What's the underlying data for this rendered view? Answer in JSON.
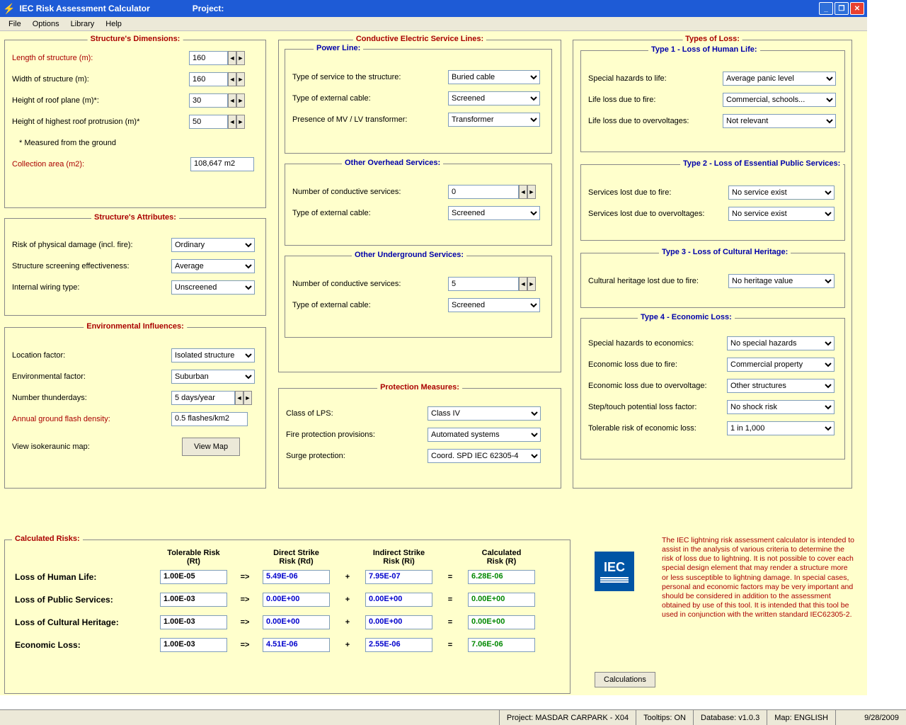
{
  "title": "IEC Risk Assessment Calculator",
  "project_label": "Project:",
  "menu": {
    "file": "File",
    "options": "Options",
    "library": "Library",
    "help": "Help"
  },
  "dims": {
    "legend": "Structure's Dimensions:",
    "length_lbl": "Length of structure (m):",
    "length_val": "160",
    "width_lbl": "Width of structure (m):",
    "width_val": "160",
    "roof_lbl": "Height of roof plane (m)*:",
    "roof_val": "30",
    "prot_lbl": "Height of highest roof protrusion (m)*",
    "prot_val": "50",
    "foot": "* Measured from the ground",
    "area_lbl": "Collection area (m2):",
    "area_val": "108,647 m2"
  },
  "attrs": {
    "legend": "Structure's Attributes:",
    "risk_lbl": "Risk of physical damage (incl. fire):",
    "risk_val": "Ordinary",
    "screen_lbl": "Structure screening effectiveness:",
    "screen_val": "Average",
    "wire_lbl": "Internal wiring type:",
    "wire_val": "Unscreened"
  },
  "env": {
    "legend": "Environmental Influences:",
    "loc_lbl": "Location factor:",
    "loc_val": "Isolated structure",
    "env_lbl": "Environmental factor:",
    "env_val": "Suburban",
    "thun_lbl": "Number thunderdays:",
    "thun_val": "5 days/year",
    "flash_lbl": "Annual ground flash density:",
    "flash_val": "0.5  flashes/km2",
    "map_lbl": "View isokeraunic map:",
    "map_btn": "View Map"
  },
  "cesl": {
    "legend": "Conductive Electric Service Lines:",
    "pl": "Power Line:",
    "type_svc_lbl": "Type of service to the structure:",
    "type_svc_val": "Buried cable",
    "ext_cable_lbl": "Type of external cable:",
    "ext_cable_val": "Screened",
    "mvlv_lbl": "Presence of MV / LV transformer:",
    "mvlv_val": "Transformer",
    "oos": "Other Overhead Services:",
    "oos_num_lbl": "Number of conductive services:",
    "oos_num_val": "0",
    "oos_ext_lbl": "Type of external cable:",
    "oos_ext_val": "Screened",
    "ous": "Other Underground Services:",
    "ous_num_lbl": "Number of conductive services:",
    "ous_num_val": "5",
    "ous_ext_lbl": "Type of external cable:",
    "ous_ext_val": "Screened"
  },
  "pm": {
    "legend": "Protection Measures:",
    "lps_lbl": "Class of LPS:",
    "lps_val": "Class IV",
    "fire_lbl": "Fire protection provisions:",
    "fire_val": "Automated systems",
    "surge_lbl": "Surge protection:",
    "surge_val": "Coord. SPD IEC 62305-4"
  },
  "types": {
    "legend": "Types of Loss:",
    "t1": "Type 1 - Loss of Human Life:",
    "t1a_lbl": "Special hazards to life:",
    "t1a_val": "Average panic level",
    "t1b_lbl": "Life loss due to fire:",
    "t1b_val": "Commercial, schools...",
    "t1c_lbl": "Life loss due to overvoltages:",
    "t1c_val": "Not relevant",
    "t2": "Type 2 - Loss of Essential Public Services:",
    "t2a_lbl": "Services lost due to fire:",
    "t2a_val": "No service exist",
    "t2b_lbl": "Services lost due to overvoltages:",
    "t2b_val": "No service exist",
    "t3": "Type 3 - Loss of Cultural Heritage:",
    "t3a_lbl": "Cultural heritage lost due to fire:",
    "t3a_val": "No heritage value",
    "t4": "Type 4 - Economic Loss:",
    "t4a_lbl": "Special hazards to economics:",
    "t4a_val": "No special hazards",
    "t4b_lbl": "Economic loss due to fire:",
    "t4b_val": "Commercial property",
    "t4c_lbl": "Economic loss due to overvoltage:",
    "t4c_val": "Other structures",
    "t4d_lbl": "Step/touch potential loss factor:",
    "t4d_val": "No shock risk",
    "t4e_lbl": "Tolerable risk of economic loss:",
    "t4e_val": "1 in 1,000"
  },
  "calc": {
    "legend": "Calculated Risks:",
    "h_tol1": "Tolerable Risk",
    "h_tol2": "(Rt)",
    "h_dir1": "Direct Strike",
    "h_dir2": "Risk (Rd)",
    "h_ind1": "Indirect Strike",
    "h_ind2": "Risk (Ri)",
    "h_cal1": "Calculated",
    "h_cal2": "Risk (R)",
    "rows": [
      {
        "lbl": "Loss of Human Life:",
        "rt": "1.00E-05",
        "rd": "5.49E-06",
        "ri": "7.95E-07",
        "r": "6.28E-06"
      },
      {
        "lbl": "Loss of Public Services:",
        "rt": "1.00E-03",
        "rd": "0.00E+00",
        "ri": "0.00E+00",
        "r": "0.00E+00"
      },
      {
        "lbl": "Loss of Cultural Heritage:",
        "rt": "1.00E-03",
        "rd": "0.00E+00",
        "ri": "0.00E+00",
        "r": "0.00E+00"
      },
      {
        "lbl": "Economic Loss:",
        "rt": "1.00E-03",
        "rd": "4.51E-06",
        "ri": "2.55E-06",
        "r": "7.06E-06"
      }
    ],
    "eq_arrow": "=>",
    "plus": "+",
    "eq": "="
  },
  "disclaimer": "The IEC lightning risk assessment calculator is intended to assist in the analysis of various criteria to determine the risk of loss due to lightning. It is not possible to cover each special design element that may render a structure more or less susceptible to lightning damage. In special cases, personal and economic factors may be very important and should be considered in addition to the assessment obtained by use of this tool. It is intended that this tool be used in conjunction with the written standard IEC62305-2.",
  "calc_btn": "Calculations",
  "logo_text": "IEC",
  "status": {
    "project": "Project: MASDAR CARPARK - X04",
    "tooltips": "Tooltips: ON",
    "db": "Database: v1.0.3",
    "map": "Map: ENGLISH",
    "date": "9/28/2009"
  }
}
